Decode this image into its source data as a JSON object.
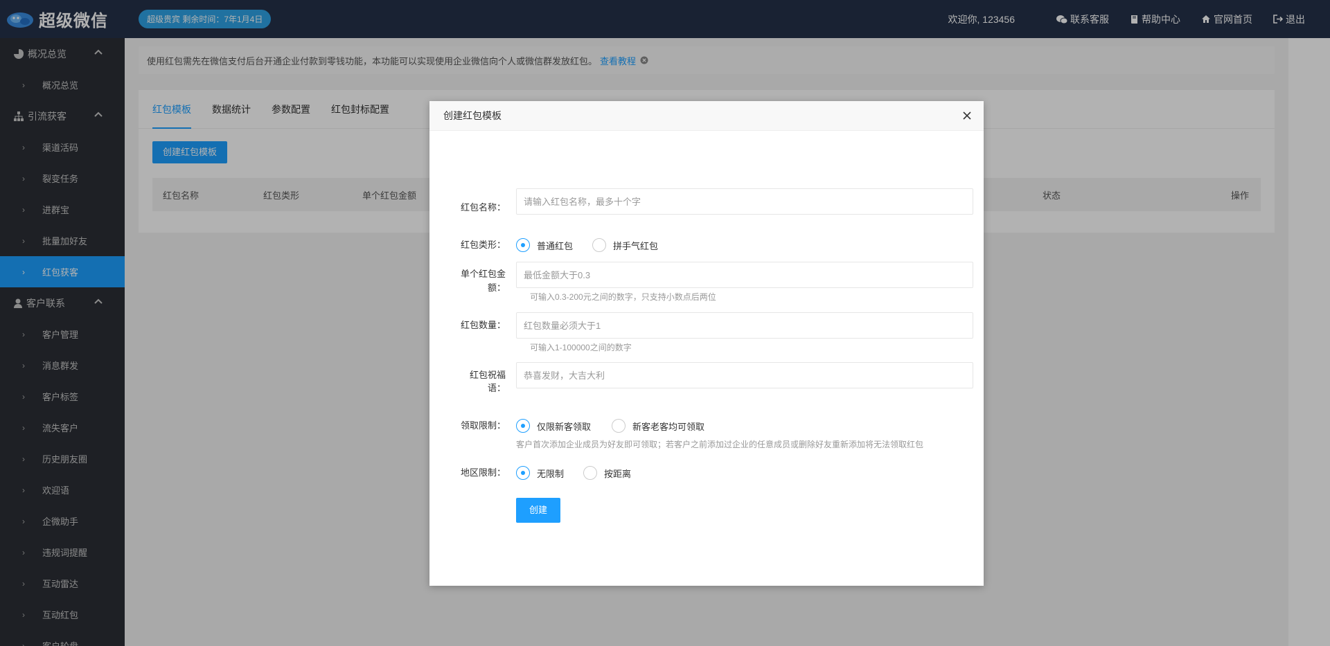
{
  "header": {
    "logo_text": "超级微信",
    "vip_badge": "超级贵宾 剩余时间：7年1月4日",
    "welcome": "欢迎你, 123456",
    "links": [
      {
        "label": "联系客服",
        "icon": "wechat-icon"
      },
      {
        "label": "帮助中心",
        "icon": "book-icon"
      },
      {
        "label": "官网首页",
        "icon": "home-icon"
      },
      {
        "label": "退出",
        "icon": "logout-icon"
      }
    ]
  },
  "sidebar": {
    "groups": [
      {
        "label": "概况总览",
        "icon": "pie-chart-icon",
        "items": [
          "概况总览"
        ]
      },
      {
        "label": "引流获客",
        "icon": "sitemap-icon",
        "items": [
          "渠道活码",
          "裂变任务",
          "进群宝",
          "批量加好友",
          "红包获客"
        ]
      },
      {
        "label": "客户联系",
        "icon": "user-icon",
        "items": [
          "客户管理",
          "消息群发",
          "客户标签",
          "流失客户",
          "历史朋友圈",
          "欢迎语",
          "企微助手",
          "违规词提醒",
          "互动雷达",
          "互动红包",
          "客户轮盘"
        ]
      }
    ],
    "active_item": "红包获客"
  },
  "notice": {
    "text": "使用红包需先在微信支付后台开通企业付款到零钱功能，本功能可以实现使用企业微信向个人或微信群发放红包。",
    "link": "查看教程"
  },
  "tabs": [
    "红包模板",
    "数据统计",
    "参数配置",
    "红包封标配置"
  ],
  "create_template_button": "创建红包模板",
  "table": {
    "columns": [
      "红包名称",
      "红包类形",
      "单个红包金额",
      "状态",
      "操作"
    ]
  },
  "modal": {
    "title": "创建红包模板",
    "fields": {
      "name": {
        "label": "红包名称：",
        "placeholder": "请输入红包名称，最多十个字"
      },
      "type": {
        "label": "红包类形：",
        "options": [
          "普通红包",
          "拼手气红包"
        ],
        "selected": "普通红包"
      },
      "amount": {
        "label_line1": "单个红包金",
        "label_line2": "额：",
        "placeholder": "最低金额大于0.3",
        "hint": "可输入0.3-200元之间的数字，只支持小数点后两位"
      },
      "count": {
        "label": "红包数量：",
        "placeholder": "红包数量必须大于1",
        "hint": "可输入1-100000之间的数字"
      },
      "greeting": {
        "label_line1": "红包祝福",
        "label_line2": "语：",
        "placeholder": "恭喜发财，大吉大利"
      },
      "limit": {
        "label": "领取限制：",
        "options": [
          "仅限新客领取",
          "新客老客均可领取"
        ],
        "selected": "仅限新客领取",
        "hint": "客户首次添加企业成员为好友即可领取；若客户之前添加过企业的任意成员或删除好友重新添加将无法领取红包"
      },
      "region": {
        "label": "地区限制：",
        "options": [
          "无限制",
          "按距离"
        ],
        "selected": "无限制"
      }
    },
    "submit": "创建"
  },
  "colors": {
    "header_bg": "#24324a",
    "sidebar_bg": "#2b2f36",
    "accent": "#1e9fff"
  }
}
